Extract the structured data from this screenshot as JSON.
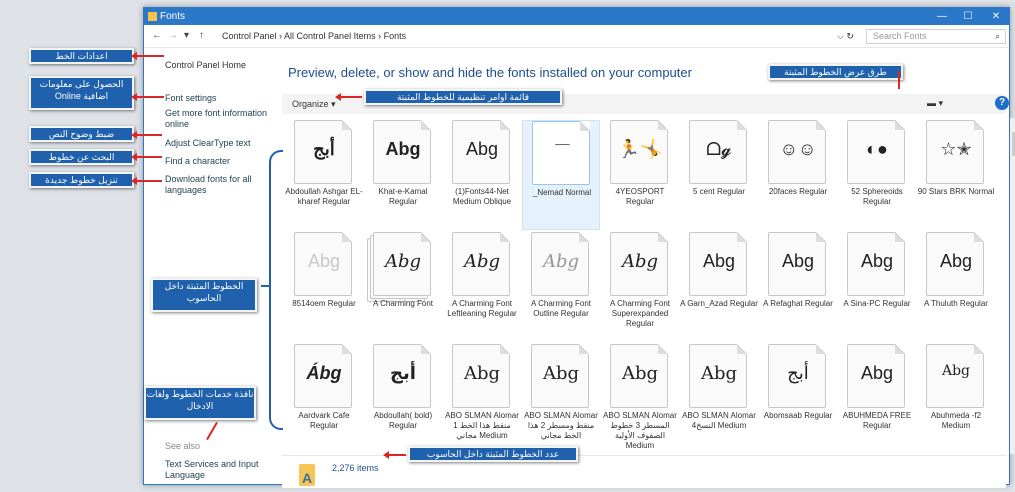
{
  "window": {
    "title": "Fonts",
    "min": "—",
    "max": "☐",
    "close": "✕"
  },
  "address": {
    "back": "←",
    "forward": "→",
    "dropdown": "▾",
    "up": "↑",
    "path": "Control Panel  ›  All Control Panel Items  ›  Fonts",
    "search_placeholder": "Search Fonts",
    "search_icon": "⌕",
    "refresh": "⌵  ↻"
  },
  "sidebar": {
    "home": "Control Panel Home",
    "links": [
      "Font settings",
      "Get more font information online",
      "Adjust ClearType text",
      "Find a character",
      "Download fonts for all languages"
    ],
    "see_also": "See also",
    "see_also_link": "Text Services and Input Language"
  },
  "main": {
    "heading": "Preview, delete, or show and hide the fonts installed on your computer",
    "organize": "Organize ▾",
    "view": "▬ ▾",
    "help": "?",
    "status_count": "2,276 items"
  },
  "fonts": [
    {
      "sample": "أبج",
      "name": "Abdoullah Ashgar EL-kharef Regular"
    },
    {
      "sample": "Abg",
      "name": "Khat-e-Kamal Regular"
    },
    {
      "sample": "Abg",
      "name": "(1)Fonts44-Net Medium Oblique"
    },
    {
      "sample": "~~~",
      "name": "_Nemad Normal"
    },
    {
      "sample": "🏃🤸",
      "name": "4YEOSPORT Regular"
    },
    {
      "sample": "ᗝ𝓰",
      "name": "5 cent Regular"
    },
    {
      "sample": "☺☺",
      "name": "20faces Regular"
    },
    {
      "sample": "◐●",
      "name": "52 Sphereoids Regular"
    },
    {
      "sample": "☆✭",
      "name": "90 Stars BRK Normal"
    },
    {
      "sample": "Abg",
      "name": "8514oem Regular"
    },
    {
      "sample": "Abg",
      "name": "A Charming Font"
    },
    {
      "sample": "Abg",
      "name": "A Charming Font Leftleaning Regular"
    },
    {
      "sample": "Abg",
      "name": "A Charming Font Outline Regular"
    },
    {
      "sample": "Abg",
      "name": "A Charming Font Superexpanded Regular"
    },
    {
      "sample": "Abg",
      "name": "A Garn_Azad Regular"
    },
    {
      "sample": "Abg",
      "name": "A Refaghat Regular"
    },
    {
      "sample": "Abg",
      "name": "A Sina-PC Regular"
    },
    {
      "sample": "Abg",
      "name": "A Thuluth Regular"
    },
    {
      "sample": "Ábg",
      "name": "Aardvark Cafe Regular"
    },
    {
      "sample": "أبج",
      "name": "Abdoullah( bold) Regular"
    },
    {
      "sample": "Abg",
      "name": "ABO SLMAN Alomar 1 منقط هذا الخط مجاني Medium"
    },
    {
      "sample": "Abg",
      "name": "ABO SLMAN Alomar منقط ومسطر 2 هذا الخط مجاني"
    },
    {
      "sample": "Abg",
      "name": "ABO SLMAN Alomar المسطر 3 خطوط الصفوف الأولية Medium"
    },
    {
      "sample": "Abg",
      "name": "ABO SLMAN Alomar النسخ4 Medium"
    },
    {
      "sample": "أبج",
      "name": "Abomsaab Regular"
    },
    {
      "sample": "Abg",
      "name": "ABUHMEDA FREE Regular"
    },
    {
      "sample": "Abg",
      "name": "Abuhmeda -f2 Medium"
    }
  ],
  "annotations": {
    "font_settings": "اعدادات الخط",
    "more_info": "الحصول على معلومات اضافية Online",
    "cleartype": "ضبط وضوح النص",
    "find_char": "البحث عن خطوط",
    "download": "تنزيل خطوط جديدة",
    "organize": "قائمة اوامر تنظيمية للخطوط المثبتة",
    "view_methods": "طرق عرض الخطوط المثبتة",
    "installed": "الخطوط المثبتة داخل الحاسوب",
    "text_services": "نافذة خدمات الخطوط ولغات الادخال",
    "count": "عدد الخطوط المثبتة داخل الحاسوب"
  }
}
